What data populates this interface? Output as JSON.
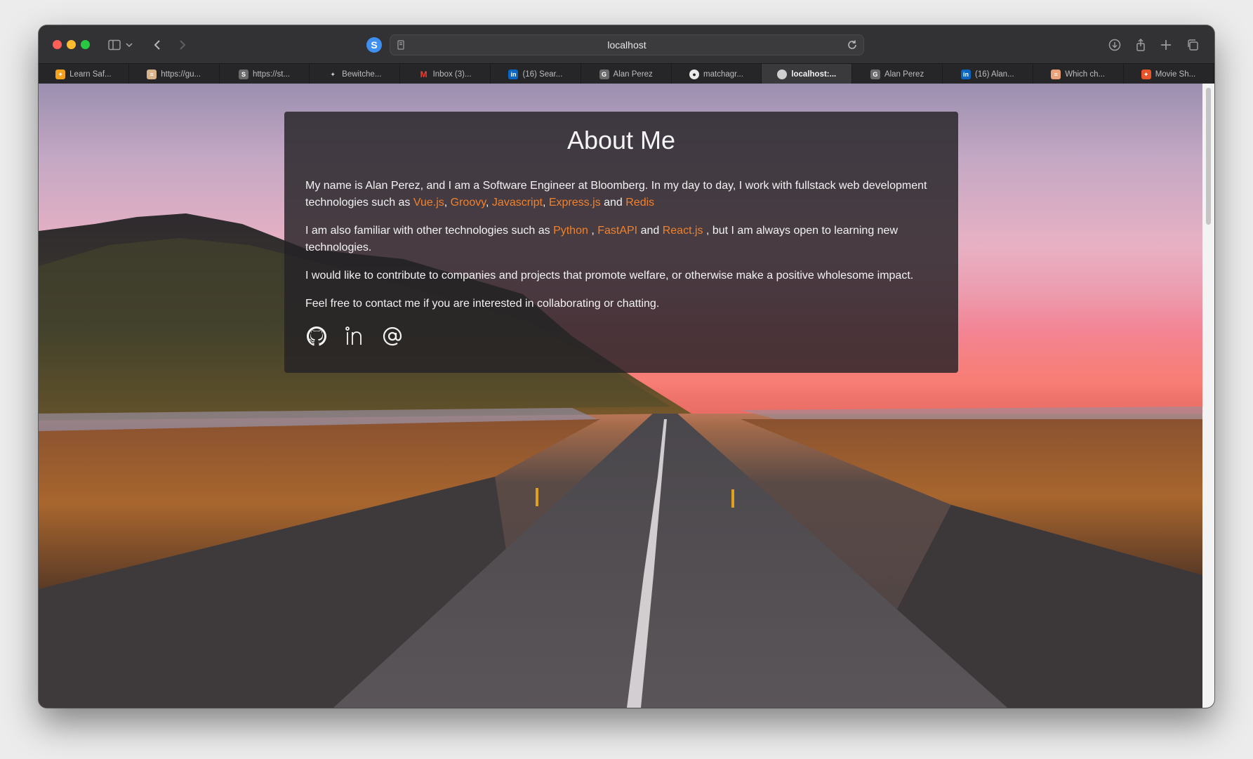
{
  "browser": {
    "address": "localhost",
    "tabs": [
      {
        "label": "Learn Saf...",
        "favicon": "safari-learn-icon",
        "color": "#f4a21b"
      },
      {
        "label": "https://gu...",
        "favicon": "document-icon",
        "color": "#d9b48a"
      },
      {
        "label": "https://st...",
        "favicon": "s-letter-icon",
        "color": "#6b6b6b"
      },
      {
        "label": "Bewitche...",
        "favicon": "sparkle-icon",
        "color": "#cfcfcf"
      },
      {
        "label": "Inbox (3)...",
        "favicon": "gmail-icon",
        "color": "#ea4335"
      },
      {
        "label": "(16) Sear...",
        "favicon": "linkedin-icon",
        "color": "#0a66c2"
      },
      {
        "label": "Alan Perez",
        "favicon": "g-letter-icon",
        "color": "#6b6b6b"
      },
      {
        "label": "matchagr...",
        "favicon": "github-icon",
        "color": "#eaeaea"
      },
      {
        "label": "localhost:...",
        "favicon": "globe-icon",
        "color": "#cfcfcf",
        "active": true
      },
      {
        "label": "Alan Perez",
        "favicon": "g-letter-icon",
        "color": "#6b6b6b"
      },
      {
        "label": "(16) Alan...",
        "favicon": "linkedin-icon",
        "color": "#0a66c2"
      },
      {
        "label": "Which ch...",
        "favicon": "document-icon",
        "color": "#e9a27a"
      },
      {
        "label": "Movie Sh...",
        "favicon": "bookmark-icon",
        "color": "#e8552b"
      }
    ]
  },
  "about": {
    "title": "About Me",
    "p1_intro": "My name is Alan Perez, and I am a Software Engineer at Bloomberg. In my day to day, I work with fullstack web development technologies such as ",
    "p1_tech": [
      "Vue.js",
      "Groovy",
      "Javascript",
      "Express.js",
      "Redis"
    ],
    "sep_comma": ", ",
    "sep_and": " and ",
    "p2_intro": "I am also familiar with other technologies such as ",
    "p2_tech": [
      "Python",
      "FastAPI",
      "React.js"
    ],
    "p2_sep1": " , ",
    "p2_sep2": " and ",
    "p2_outro": " , but I am always open to learning new technologies.",
    "p3": "I would like to contribute to companies and projects that promote welfare, or otherwise make a positive wholesome impact.",
    "p4": "Feel free to contact me if you are interested in collaborating or chatting.",
    "socials": [
      "github-icon",
      "linkedin-icon",
      "at-sign-icon"
    ]
  },
  "colors": {
    "accent": "#f0812e",
    "card_bg": "#242226"
  }
}
